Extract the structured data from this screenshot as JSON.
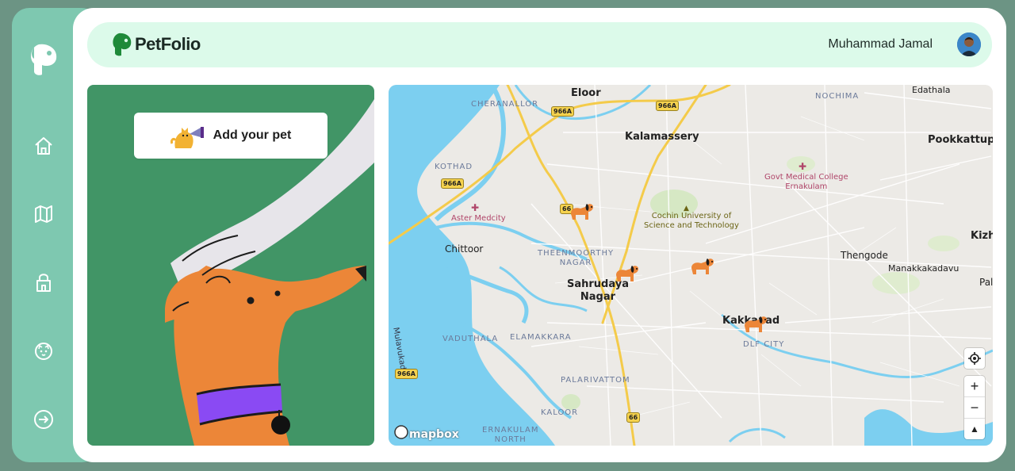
{
  "sidebar": {
    "items": [
      {
        "name": "home",
        "icon": "home-icon"
      },
      {
        "name": "map",
        "icon": "map-icon"
      },
      {
        "name": "shop",
        "icon": "shopping-bag-icon"
      },
      {
        "name": "pets",
        "icon": "cat-face-icon"
      },
      {
        "name": "logout",
        "icon": "logout-icon"
      }
    ]
  },
  "header": {
    "brand": "PetFolio",
    "user_name": "Muhammad Jamal"
  },
  "pet_card": {
    "add_label": "Add your pet"
  },
  "map": {
    "towns": [
      "Eloor",
      "Kalamassery",
      "Pookkattupa",
      "Sahrudaya\nNagar",
      "Kakkanad",
      "Chittoor",
      "Thengode",
      "Manakkakadavu",
      "Kizh",
      "Pal",
      "Edathala"
    ],
    "areas": [
      "CHERANALLOR",
      "NOCHIMA",
      "KOTHAD",
      "THEENMOORTHY\nNAGAR",
      "VADUTHALA",
      "ELAMAKKARA",
      "PALARIVATTOM",
      "KALOOR",
      "ERNAKULAM\nNORTH",
      "DLF CITY"
    ],
    "pois": [
      "Aster Medcity",
      "Govt Medical College\nErnakulam",
      "Cochin University of\nScience and Technology"
    ],
    "roads": [
      "Mulavukad"
    ],
    "shields": [
      "966A",
      "966A",
      "966A",
      "966A",
      "66",
      "66"
    ],
    "attribution": "mapbox",
    "controls": {
      "locate": "locate-icon",
      "zoom_in": "+",
      "zoom_out": "−",
      "compass": "▲"
    }
  },
  "colors": {
    "accent_green": "#419566",
    "sidebar_teal": "#7ec8b0",
    "header_mint": "#dcfaea",
    "water": "#7ccff0"
  }
}
